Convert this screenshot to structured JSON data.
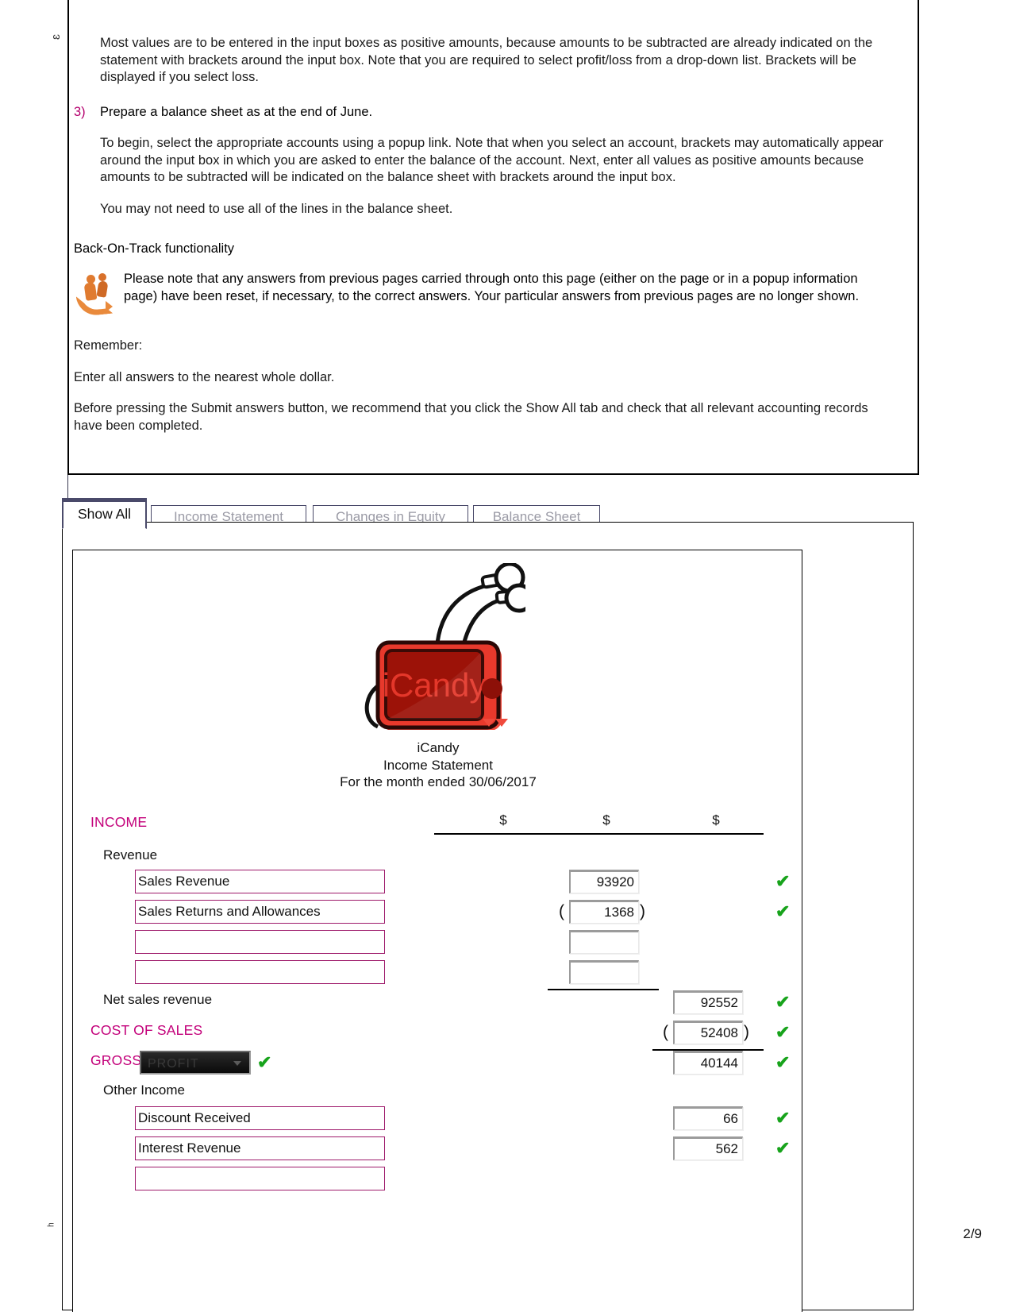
{
  "margins": {
    "top_glyph": "ɛ",
    "bottom_glyph": "ʰ",
    "page_number": "2/9"
  },
  "instructions": {
    "paragraph_1": "Most values are to be entered in the input boxes as positive amounts, because amounts to be subtracted are already indicated on the statement with brackets around the input box. Note that you are required to select profit/loss from a drop-down list. Brackets will be displayed if you select loss.",
    "item_3_number": "3)",
    "item_3_text": "Prepare a balance sheet as at the end of June.",
    "paragraph_2": "To begin, select the appropriate accounts using a popup link. Note that when you select an account, brackets may automatically appear around the input box in which you are asked to enter the balance of the account. Next, enter all values as positive amounts because amounts to be subtracted will be indicated on the balance sheet with brackets around the input box.",
    "paragraph_3": "You may not need to use all of the lines in the balance sheet.",
    "back_on_track_heading": "Back-On-Track functionality",
    "back_on_track_text": "Please note that any answers from previous pages carried through onto this page (either on the page or in a popup information page) have been reset, if necessary, to the correct answers. Your particular answers from previous pages are no longer shown.",
    "remember_heading": "Remember:",
    "remember_line_1": "Enter all answers to the nearest whole dollar.",
    "remember_line_2": "Before pressing the Submit answers button, we recommend that you click the Show All tab and check that all relevant accounting records have been completed."
  },
  "tabs": [
    {
      "label": "Show All",
      "active": true
    },
    {
      "label": "Income Statement",
      "active": false
    },
    {
      "label": "Changes in Equity",
      "active": false
    },
    {
      "label": "Balance Sheet",
      "active": false
    }
  ],
  "statement": {
    "logo_text": "iCandy",
    "company": "iCandy",
    "title": "Income Statement",
    "period": "For the month ended 30/06/2017",
    "currency_headers": [
      "$",
      "$",
      "$"
    ],
    "section_income": "INCOME",
    "subheading_revenue": "Revenue",
    "rows": [
      {
        "name": "Sales Revenue",
        "value": "93920",
        "bracketed": false,
        "column": 1,
        "ticked": true
      },
      {
        "name": "Sales Returns and Allowances",
        "value": "1368",
        "bracketed": true,
        "column": 1,
        "ticked": true
      },
      {
        "name": "",
        "value": "",
        "bracketed": false,
        "column": 1,
        "ticked": false
      },
      {
        "name": "",
        "value": "",
        "bracketed": false,
        "column": 1,
        "ticked": false
      }
    ],
    "net_sales_label": "Net sales revenue",
    "net_sales_value": "92552",
    "net_sales_ticked": true,
    "cost_of_sales_label": "COST OF SALES",
    "cost_of_sales_value": "52408",
    "cost_of_sales_bracketed": true,
    "cost_of_sales_ticked": true,
    "gross_label": "GROSS",
    "gross_select_value": "PROFIT",
    "gross_value": "40144",
    "gross_ticked": true,
    "other_income_label": "Other Income",
    "other_income_rows": [
      {
        "name": "Discount Received",
        "value": "66",
        "ticked": true
      },
      {
        "name": "Interest Revenue",
        "value": "562",
        "ticked": true
      },
      {
        "name": "",
        "value": "",
        "ticked": false
      }
    ]
  },
  "colors": {
    "accent_magenta": "#c3007a",
    "box_border_magenta": "#9e1a6b",
    "tab_border": "#4a4a6a",
    "tick_green": "#17a31b",
    "logo_red": "#d8352a"
  }
}
